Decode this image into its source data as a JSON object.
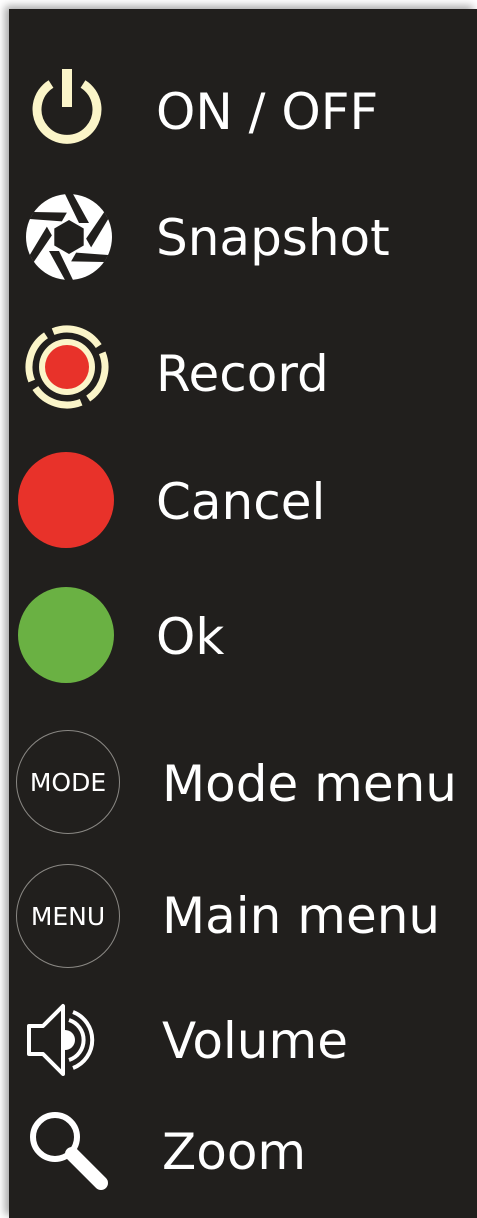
{
  "colors": {
    "panel_background": "#211f1d",
    "label_text": "#ffffff",
    "power_icon": "#fbf5c9",
    "record_ring": "#fbf5c9",
    "red": "#e8322a",
    "green": "#6ab143",
    "button_border": "#8a8884"
  },
  "items": [
    {
      "icon": "power-icon",
      "label": "ON / OFF"
    },
    {
      "icon": "aperture-icon",
      "label": "Snapshot"
    },
    {
      "icon": "record-icon",
      "label": "Record"
    },
    {
      "icon": "red-circle-icon",
      "label": "Cancel"
    },
    {
      "icon": "green-circle-icon",
      "label": "Ok"
    },
    {
      "icon": "mode-button",
      "icon_text": "MODE",
      "label": "Mode menu"
    },
    {
      "icon": "menu-button",
      "icon_text": "MENU",
      "label": "Main menu"
    },
    {
      "icon": "speaker-icon",
      "label": "Volume"
    },
    {
      "icon": "magnifier-icon",
      "label": "Zoom"
    }
  ]
}
